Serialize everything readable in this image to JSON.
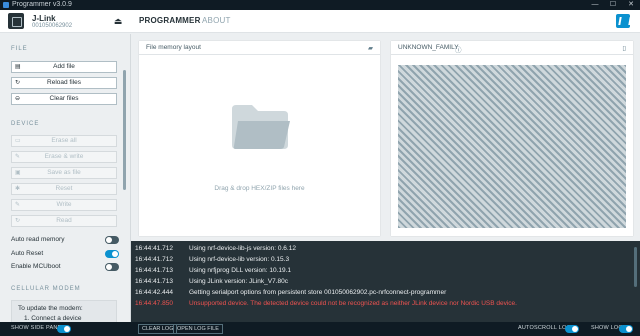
{
  "window": {
    "title": "Programmer v3.0.9",
    "controls": [
      "—",
      "☐",
      "✕"
    ]
  },
  "header": {
    "device_name": "J-Link",
    "device_serial": "001050062902",
    "tabs": [
      {
        "label": "PROGRAMMER",
        "active": true
      },
      {
        "label": "ABOUT",
        "active": false
      }
    ],
    "brand_color": "#0b91cf"
  },
  "sidebar": {
    "file_section": {
      "title": "FILE",
      "buttons": [
        {
          "label": "Add file",
          "icon": "file-icon"
        },
        {
          "label": "Reload files",
          "icon": "reload-icon"
        },
        {
          "label": "Clear files",
          "icon": "clear-icon"
        }
      ]
    },
    "device_section": {
      "title": "DEVICE",
      "buttons": [
        {
          "label": "Erase all",
          "icon": "erase-icon",
          "disabled": true
        },
        {
          "label": "Erase & write",
          "icon": "pencil-icon",
          "disabled": true
        },
        {
          "label": "Save as file",
          "icon": "save-icon",
          "disabled": true
        },
        {
          "label": "Reset",
          "icon": "reset-icon",
          "disabled": true
        },
        {
          "label": "Write",
          "icon": "pencil-icon",
          "disabled": true
        },
        {
          "label": "Read",
          "icon": "refresh-icon",
          "disabled": true
        }
      ]
    },
    "toggles": [
      {
        "label": "Auto read memory",
        "on": false
      },
      {
        "label": "Auto Reset",
        "on": true
      },
      {
        "label": "Enable MCUboot",
        "on": false
      }
    ],
    "modem_section": {
      "title": "CELLULAR MODEM",
      "line1": "To update the modem:",
      "line2": "1. Connect a device"
    }
  },
  "main": {
    "file_panel": {
      "title": "File memory layout",
      "drop_text": "Drag & drop HEX/ZIP files here"
    },
    "device_panel": {
      "title": "UNKNOWN_FAMILY"
    }
  },
  "log": {
    "lines": [
      {
        "time": "16:44:41.712",
        "message": "Using nrf-device-lib-js version: 0.6.12",
        "level": "info"
      },
      {
        "time": "16:44:41.712",
        "message": "Using nrf-device-lib version: 0.15.3",
        "level": "info"
      },
      {
        "time": "16:44:41.713",
        "message": "Using nrfjprog DLL version: 10.19.1",
        "level": "info"
      },
      {
        "time": "16:44:41.713",
        "message": "Using JLink version: JLink_V7.80c",
        "level": "info"
      },
      {
        "time": "16:44:42.444",
        "message": "Getting serialport options from persistent store 001050062902.pc-nrfconnect-programmer",
        "level": "info"
      },
      {
        "time": "16:44:47.850",
        "message": "Unsupported device. The detected device could not be recognized as neither JLink device nor Nordic USB device.",
        "level": "error"
      }
    ]
  },
  "footer": {
    "show_side_panel": {
      "label": "SHOW SIDE PANEL",
      "on": true
    },
    "clear_log": "CLEAR LOG",
    "open_log_file": "OPEN LOG FILE",
    "autoscroll_log": {
      "label": "AUTOSCROLL LOG",
      "on": true
    },
    "show_log": {
      "label": "SHOW LOG",
      "on": true
    }
  },
  "colors": {
    "accent": "#0b91cf",
    "error": "#ef5350",
    "log_bg": "#263238",
    "titlebar_bg": "#0f1b24"
  }
}
